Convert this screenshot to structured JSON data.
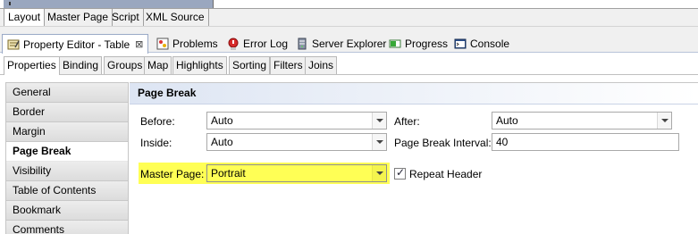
{
  "editor_tabs": [
    "Layout",
    "Master Page",
    "Script",
    "XML Source"
  ],
  "view_tabs": [
    {
      "label": "Property Editor - Table",
      "icon": "property-editor-icon",
      "closable": true
    },
    {
      "label": "Problems",
      "icon": "problems-icon"
    },
    {
      "label": "Error Log",
      "icon": "error-log-icon"
    },
    {
      "label": "Server Explorer",
      "icon": "server-explorer-icon"
    },
    {
      "label": "Progress",
      "icon": "progress-icon"
    },
    {
      "label": "Console",
      "icon": "console-icon"
    }
  ],
  "property_tabs": [
    "Properties",
    "Binding",
    "Groups",
    "Map",
    "Highlights",
    "Sorting",
    "Filters",
    "Joins"
  ],
  "nav_items": [
    "General",
    "Border",
    "Margin",
    "Page Break",
    "Visibility",
    "Table of Contents",
    "Bookmark",
    "Comments"
  ],
  "section_title": "Page Break",
  "form": {
    "before_label": "Before:",
    "before_value": "Auto",
    "after_label": "After:",
    "after_value": "Auto",
    "inside_label": "Inside:",
    "inside_value": "Auto",
    "interval_label": "Page Break Interval:",
    "interval_value": "40",
    "master_page_label": "Master Page:",
    "master_page_value": "Portrait",
    "repeat_header_label": "Repeat Header",
    "repeat_header_checked": true
  },
  "colors": {
    "highlight": "#ffff55",
    "header_gradient_start": "#dde5f3"
  }
}
